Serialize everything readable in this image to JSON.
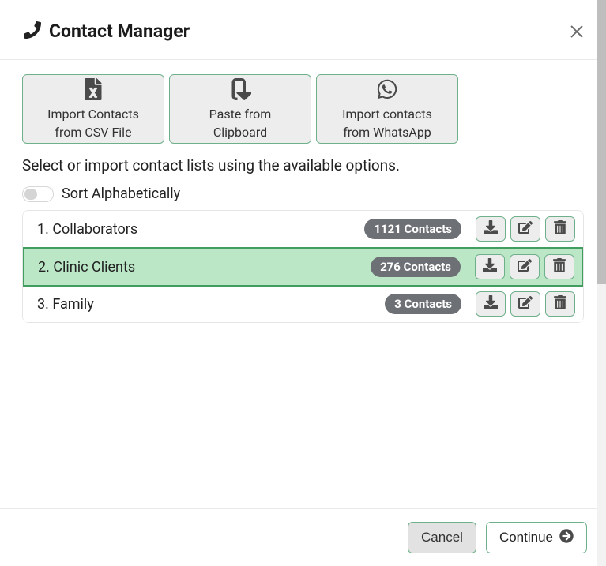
{
  "header": {
    "title": "Contact Manager"
  },
  "import_options": [
    {
      "line1": "Import Contacts",
      "line2": "from CSV File"
    },
    {
      "line1": "Paste from",
      "line2": "Clipboard"
    },
    {
      "line1": "Import contacts",
      "line2": "from WhatsApp"
    }
  ],
  "instruction": "Select or import contact lists using the available options.",
  "sort": {
    "label": "Sort Alphabetically",
    "on": false
  },
  "lists": [
    {
      "index": 1,
      "name": "Collaborators",
      "count": 1121,
      "selected": false
    },
    {
      "index": 2,
      "name": "Clinic Clients",
      "count": 276,
      "selected": true
    },
    {
      "index": 3,
      "name": "Family",
      "count": 3,
      "selected": false
    }
  ],
  "badge_suffix": " Contacts",
  "footer": {
    "cancel": "Cancel",
    "continue": "Continue"
  }
}
